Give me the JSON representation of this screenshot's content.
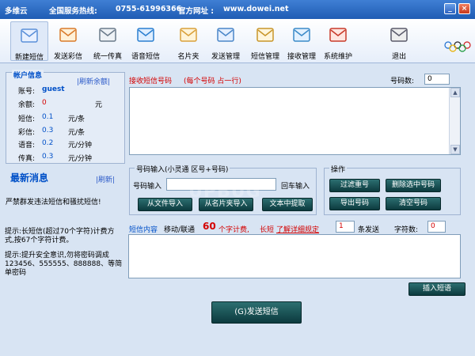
{
  "titlebar": {
    "app": "多维云",
    "hotline_label": "全国服务热线:",
    "hotline": "0755-61996366",
    "site_label": "官方网址 :",
    "site": "www.dowei.net",
    "min": "_",
    "close": "×"
  },
  "toolbar": [
    {
      "label": "新建短信",
      "icon": "new-sms-icon",
      "active": true
    },
    {
      "label": "发送彩信",
      "icon": "mms-icon",
      "active": false
    },
    {
      "label": "统一传真",
      "icon": "fax-icon",
      "active": false
    },
    {
      "label": "语音短信",
      "icon": "voice-phone-icon",
      "active": false
    },
    {
      "label": "名片夹",
      "icon": "contacts-folder-icon",
      "active": false
    },
    {
      "label": "发送管理",
      "icon": "send-manage-icon",
      "active": false
    },
    {
      "label": "短信管理",
      "icon": "sms-manage-icon",
      "active": false
    },
    {
      "label": "接收管理",
      "icon": "receive-manage-icon",
      "active": false
    },
    {
      "label": "系统维护",
      "icon": "tools-icon",
      "active": false
    },
    {
      "label": "退出",
      "icon": "exit-icon",
      "active": false
    }
  ],
  "account": {
    "title": "帐户信息",
    "refresh": "|刷新余额|",
    "rows": [
      {
        "label": "账号:",
        "value": "guest",
        "unit": ""
      },
      {
        "label": "余额:",
        "value": "0",
        "unit": "元"
      },
      {
        "label": "短信:",
        "value": "0.1",
        "unit": "元/条"
      },
      {
        "label": "彩信:",
        "value": "0.3",
        "unit": "元/条"
      },
      {
        "label": "语音:",
        "value": "0.2",
        "unit": "元/分钟"
      },
      {
        "label": "传真:",
        "value": "0.3",
        "unit": "元/分钟"
      }
    ]
  },
  "news": {
    "title": "最新消息",
    "refresh": "|刷新|",
    "message": "严禁群发违法短信和骚扰短信!"
  },
  "tips": {
    "tip1": "提示:长短信(超过70个字符)计费方式,按67个字符计费。",
    "tip2": "提示:提升安全意识,勿将密码调成 123456、555555、888888、等简单密码"
  },
  "receiver": {
    "label": "接收短信号码",
    "hint": "(每个号码 占一行)",
    "count_label": "号码数:",
    "count_value": "0"
  },
  "number_input": {
    "legend": "号码输入(小灵通 区号+号码)",
    "field_label": "号码输入",
    "enter_label": "回车输入",
    "value": "",
    "btn1": "从文件导入",
    "btn2": "从名片夹导入",
    "btn3": "文本中提取"
  },
  "ops": {
    "legend": "操作",
    "filter_dup": "过滤重号",
    "delete_selected": "删除选中号码",
    "export": "导出号码",
    "clear": "清空号码"
  },
  "content": {
    "label": "短信内容",
    "carrier": "移动/联通",
    "per_sms": "60",
    "per_sms_unit": "个字计费,",
    "long_sms": "长短",
    "learn_more": "了解详细规定",
    "send_count": "1",
    "send_unit": "条发送",
    "char_label": "字符数:",
    "char_count": "0",
    "value": ""
  },
  "insert_sms": "插入短语",
  "send_btn": "(G)发送短信",
  "colors": {
    "teal": "#1b5457",
    "red": "#d40000",
    "blue": "#0050c8"
  }
}
